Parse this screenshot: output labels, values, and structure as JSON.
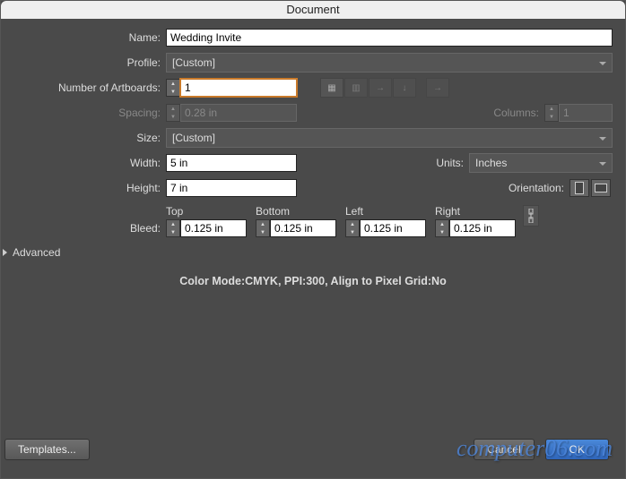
{
  "title": "Document",
  "name": {
    "label": "Name:",
    "value": "Wedding Invite"
  },
  "profile": {
    "label": "Profile:",
    "value": "[Custom]"
  },
  "artboards": {
    "label": "Number of Artboards:",
    "value": "1"
  },
  "spacing": {
    "label": "Spacing:",
    "value": "0.28 in"
  },
  "columns": {
    "label": "Columns:",
    "value": "1"
  },
  "size": {
    "label": "Size:",
    "value": "[Custom]"
  },
  "width": {
    "label": "Width:",
    "value": "5 in"
  },
  "height": {
    "label": "Height:",
    "value": "7 in"
  },
  "units": {
    "label": "Units:",
    "value": "Inches"
  },
  "orientation": {
    "label": "Orientation:"
  },
  "bleed": {
    "label": "Bleed:",
    "top": {
      "label": "Top",
      "value": "0.125 in"
    },
    "bottom": {
      "label": "Bottom",
      "value": "0.125 in"
    },
    "left": {
      "label": "Left",
      "value": "0.125 in"
    },
    "right": {
      "label": "Right",
      "value": "0.125 in"
    }
  },
  "advanced": "Advanced",
  "summary": "Color Mode:CMYK, PPI:300, Align to Pixel Grid:No",
  "buttons": {
    "templates": "Templates...",
    "cancel": "Cancel",
    "ok": "OK"
  },
  "watermark": "computer06.com"
}
